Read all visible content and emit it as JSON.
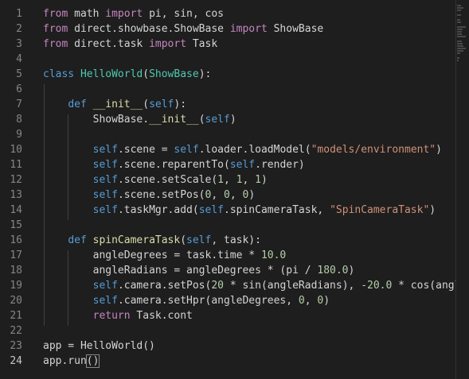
{
  "editor": {
    "active_line": 24,
    "lines": [
      {
        "n": "1",
        "tokens": [
          {
            "t": "from",
            "c": "imp"
          },
          {
            "t": " math ",
            "c": ""
          },
          {
            "t": "import",
            "c": "imp"
          },
          {
            "t": " pi, sin, cos",
            "c": ""
          }
        ]
      },
      {
        "n": "2",
        "tokens": [
          {
            "t": "from",
            "c": "imp"
          },
          {
            "t": " direct.showbase.ShowBase ",
            "c": ""
          },
          {
            "t": "import",
            "c": "imp"
          },
          {
            "t": " ShowBase",
            "c": ""
          }
        ]
      },
      {
        "n": "3",
        "tokens": [
          {
            "t": "from",
            "c": "imp"
          },
          {
            "t": " direct.task ",
            "c": ""
          },
          {
            "t": "import",
            "c": "imp"
          },
          {
            "t": " Task",
            "c": ""
          }
        ]
      },
      {
        "n": "4",
        "tokens": []
      },
      {
        "n": "5",
        "tokens": [
          {
            "t": "class",
            "c": "kw"
          },
          {
            "t": " ",
            "c": ""
          },
          {
            "t": "HelloWorld",
            "c": "cls"
          },
          {
            "t": "(",
            "c": ""
          },
          {
            "t": "ShowBase",
            "c": "cls"
          },
          {
            "t": "):",
            "c": ""
          }
        ]
      },
      {
        "n": "6",
        "tokens": []
      },
      {
        "n": "7",
        "tokens": [
          {
            "t": "    ",
            "c": ""
          },
          {
            "t": "def",
            "c": "kw"
          },
          {
            "t": " ",
            "c": ""
          },
          {
            "t": "__init__",
            "c": "fn"
          },
          {
            "t": "(",
            "c": ""
          },
          {
            "t": "self",
            "c": "self"
          },
          {
            "t": "):",
            "c": ""
          }
        ]
      },
      {
        "n": "8",
        "tokens": [
          {
            "t": "        ShowBase.",
            "c": ""
          },
          {
            "t": "__init__",
            "c": "fn"
          },
          {
            "t": "(",
            "c": ""
          },
          {
            "t": "self",
            "c": "self"
          },
          {
            "t": ")",
            "c": ""
          }
        ]
      },
      {
        "n": "9",
        "tokens": []
      },
      {
        "n": "10",
        "tokens": [
          {
            "t": "        ",
            "c": ""
          },
          {
            "t": "self",
            "c": "self"
          },
          {
            "t": ".scene = ",
            "c": ""
          },
          {
            "t": "self",
            "c": "self"
          },
          {
            "t": ".loader.loadModel(",
            "c": ""
          },
          {
            "t": "\"models/environment\"",
            "c": "str"
          },
          {
            "t": ")",
            "c": ""
          }
        ]
      },
      {
        "n": "11",
        "tokens": [
          {
            "t": "        ",
            "c": ""
          },
          {
            "t": "self",
            "c": "self"
          },
          {
            "t": ".scene.reparentTo(",
            "c": ""
          },
          {
            "t": "self",
            "c": "self"
          },
          {
            "t": ".render)",
            "c": ""
          }
        ]
      },
      {
        "n": "12",
        "tokens": [
          {
            "t": "        ",
            "c": ""
          },
          {
            "t": "self",
            "c": "self"
          },
          {
            "t": ".scene.setScale(",
            "c": ""
          },
          {
            "t": "1",
            "c": "num"
          },
          {
            "t": ", ",
            "c": ""
          },
          {
            "t": "1",
            "c": "num"
          },
          {
            "t": ", ",
            "c": ""
          },
          {
            "t": "1",
            "c": "num"
          },
          {
            "t": ")",
            "c": ""
          }
        ]
      },
      {
        "n": "13",
        "tokens": [
          {
            "t": "        ",
            "c": ""
          },
          {
            "t": "self",
            "c": "self"
          },
          {
            "t": ".scene.setPos(",
            "c": ""
          },
          {
            "t": "0",
            "c": "num"
          },
          {
            "t": ", ",
            "c": ""
          },
          {
            "t": "0",
            "c": "num"
          },
          {
            "t": ", ",
            "c": ""
          },
          {
            "t": "0",
            "c": "num"
          },
          {
            "t": ")",
            "c": ""
          }
        ]
      },
      {
        "n": "14",
        "tokens": [
          {
            "t": "        ",
            "c": ""
          },
          {
            "t": "self",
            "c": "self"
          },
          {
            "t": ".taskMgr.add(",
            "c": ""
          },
          {
            "t": "self",
            "c": "self"
          },
          {
            "t": ".spinCameraTask, ",
            "c": ""
          },
          {
            "t": "\"SpinCameraTask\"",
            "c": "str"
          },
          {
            "t": ")",
            "c": ""
          }
        ]
      },
      {
        "n": "15",
        "tokens": []
      },
      {
        "n": "16",
        "tokens": [
          {
            "t": "    ",
            "c": ""
          },
          {
            "t": "def",
            "c": "kw"
          },
          {
            "t": " ",
            "c": ""
          },
          {
            "t": "spinCameraTask",
            "c": "fn"
          },
          {
            "t": "(",
            "c": ""
          },
          {
            "t": "self",
            "c": "self"
          },
          {
            "t": ", task):",
            "c": ""
          }
        ]
      },
      {
        "n": "17",
        "tokens": [
          {
            "t": "        angleDegrees = task.time * ",
            "c": ""
          },
          {
            "t": "10.0",
            "c": "num"
          }
        ]
      },
      {
        "n": "18",
        "tokens": [
          {
            "t": "        angleRadians = angleDegrees * (pi / ",
            "c": ""
          },
          {
            "t": "180.0",
            "c": "num"
          },
          {
            "t": ")",
            "c": ""
          }
        ]
      },
      {
        "n": "19",
        "tokens": [
          {
            "t": "        ",
            "c": ""
          },
          {
            "t": "self",
            "c": "self"
          },
          {
            "t": ".camera.setPos(",
            "c": ""
          },
          {
            "t": "20",
            "c": "num"
          },
          {
            "t": " * sin(angleRadians), ",
            "c": ""
          },
          {
            "t": "-20.0",
            "c": "num"
          },
          {
            "t": " * cos(angle",
            "c": ""
          }
        ]
      },
      {
        "n": "20",
        "tokens": [
          {
            "t": "        ",
            "c": ""
          },
          {
            "t": "self",
            "c": "self"
          },
          {
            "t": ".camera.setHpr(angleDegrees, ",
            "c": ""
          },
          {
            "t": "0",
            "c": "num"
          },
          {
            "t": ", ",
            "c": ""
          },
          {
            "t": "0",
            "c": "num"
          },
          {
            "t": ")",
            "c": ""
          }
        ]
      },
      {
        "n": "21",
        "tokens": [
          {
            "t": "        ",
            "c": ""
          },
          {
            "t": "return",
            "c": "imp"
          },
          {
            "t": " Task.cont",
            "c": ""
          }
        ]
      },
      {
        "n": "22",
        "tokens": []
      },
      {
        "n": "23",
        "tokens": [
          {
            "t": "app = HelloWorld()",
            "c": ""
          }
        ]
      },
      {
        "n": "24",
        "tokens": [
          {
            "t": "app.run",
            "c": ""
          },
          {
            "t": "()",
            "c": "bracket"
          }
        ]
      }
    ]
  },
  "colors": {
    "background": "#1e1e1e",
    "keyword": "#569cd6",
    "import_keyword": "#c586c0",
    "function": "#dcdcaa",
    "class": "#4ec9b0",
    "string": "#ce9178",
    "number": "#b5cea8",
    "line_number": "#858585"
  }
}
